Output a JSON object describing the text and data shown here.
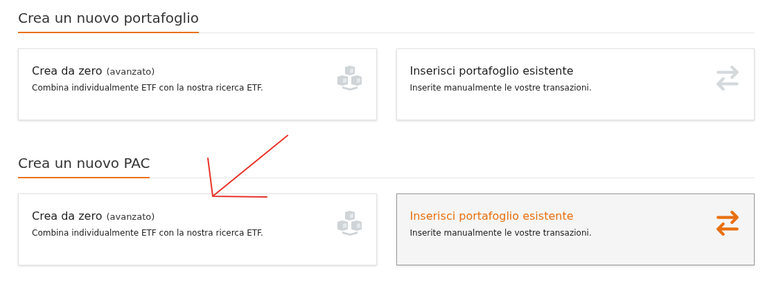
{
  "sections": [
    {
      "heading": "Crea un nuovo portafoglio",
      "cards": [
        {
          "kind": "build",
          "title": "Crea da zero",
          "note": "(avanzato)",
          "description": "Combina individualmente ETF con la nostra ricerca ETF.",
          "selected": false
        },
        {
          "kind": "import",
          "title": "Inserisci portafoglio esistente",
          "description": "Inserite manualmente le vostre transazioni.",
          "selected": false
        }
      ]
    },
    {
      "heading": "Crea un nuovo PAC",
      "cards": [
        {
          "kind": "build",
          "title": "Crea da zero",
          "note": "(avanzato)",
          "description": "Combina individualmente ETF con la nostra ricerca ETF.",
          "selected": false
        },
        {
          "kind": "import",
          "title": "Inserisci portafoglio esistente",
          "description": "Inserite manualmente le vostre transazioni.",
          "selected": true
        }
      ]
    }
  ]
}
